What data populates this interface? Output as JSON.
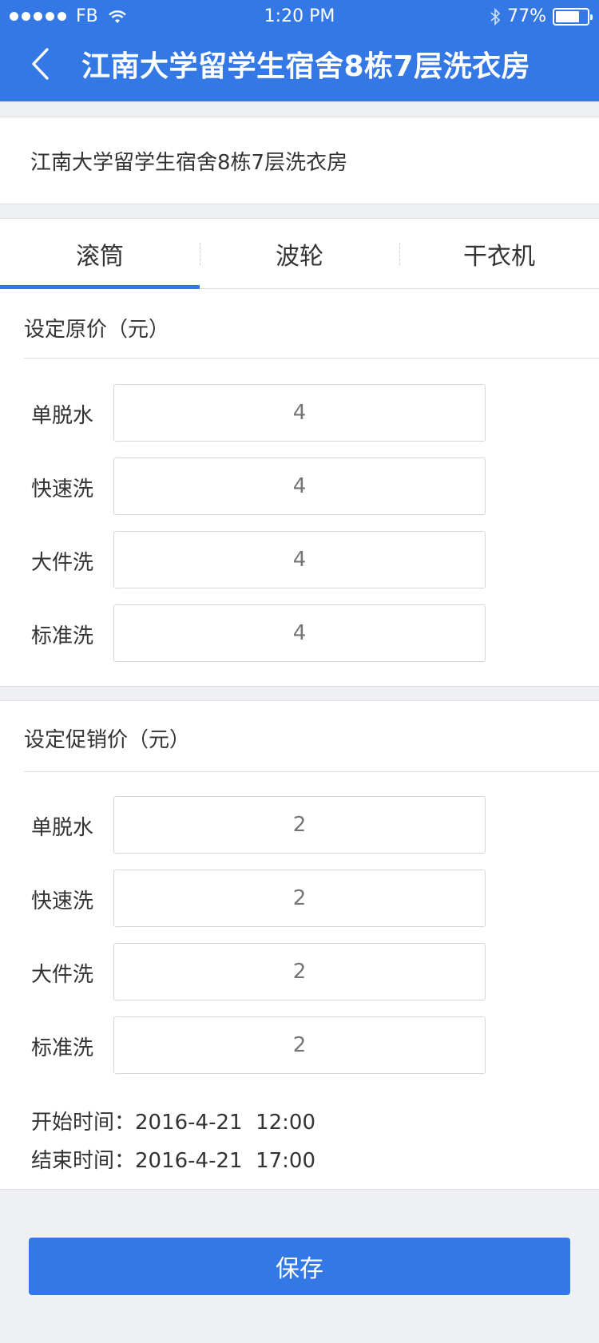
{
  "status_bar": {
    "carrier": "FB",
    "time": "1:20 PM",
    "battery_percent": "77%",
    "battery_level": 0.77
  },
  "nav": {
    "title": "江南大学留学生宿舍8栋7层洗衣房",
    "back_icon": "chevron-left-icon"
  },
  "store": {
    "name": "江南大学留学生宿舍8栋7层洗衣房"
  },
  "tabs": [
    {
      "label": "滚筒",
      "selected": true
    },
    {
      "label": "波轮",
      "selected": false
    },
    {
      "label": "干衣机",
      "selected": false
    }
  ],
  "original_price": {
    "title": "设定原价（元）",
    "rows": [
      {
        "label": "单脱水",
        "placeholder": "4"
      },
      {
        "label": "快速洗",
        "placeholder": "4"
      },
      {
        "label": "大件洗",
        "placeholder": "4"
      },
      {
        "label": "标准洗",
        "placeholder": "4"
      }
    ]
  },
  "promo_price": {
    "title": "设定促销价（元）",
    "rows": [
      {
        "label": "单脱水",
        "placeholder": "2"
      },
      {
        "label": "快速洗",
        "placeholder": "2"
      },
      {
        "label": "大件洗",
        "placeholder": "2"
      },
      {
        "label": "标准洗",
        "placeholder": "2"
      }
    ],
    "start_time": "开始时间：2016-4-21  12:00",
    "end_time": "结束时间：2016-4-21  17:00"
  },
  "save_label": "保存",
  "colors": {
    "accent": "#3478e6",
    "background": "#eff0f4"
  }
}
